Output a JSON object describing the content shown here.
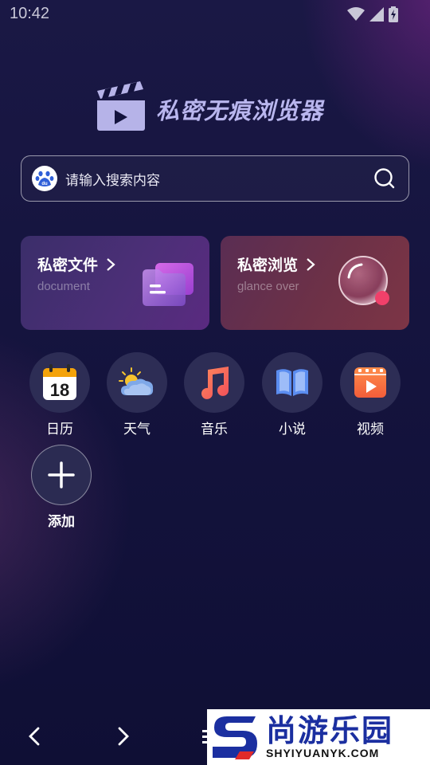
{
  "status": {
    "time": "10:42"
  },
  "app": {
    "title": "私密无痕浏览器"
  },
  "search": {
    "placeholder": "请输入搜索内容"
  },
  "cards": [
    {
      "title": "私密文件",
      "subtitle": "document"
    },
    {
      "title": "私密浏览",
      "subtitle": "glance over"
    }
  ],
  "apps": [
    {
      "label": "日历",
      "icon": "calendar-icon",
      "badge": "18"
    },
    {
      "label": "天气",
      "icon": "weather-icon"
    },
    {
      "label": "音乐",
      "icon": "music-icon"
    },
    {
      "label": "小说",
      "icon": "book-icon"
    },
    {
      "label": "视频",
      "icon": "video-icon"
    }
  ],
  "add": {
    "label": "添加"
  },
  "watermark": {
    "cn": "尚游乐园",
    "en": "SHYIYUANYK.COM"
  },
  "colors": {
    "background": "#14133d",
    "accent": "#b9b6ee",
    "card_left": "#4d2f78",
    "card_right": "#6d3147"
  }
}
